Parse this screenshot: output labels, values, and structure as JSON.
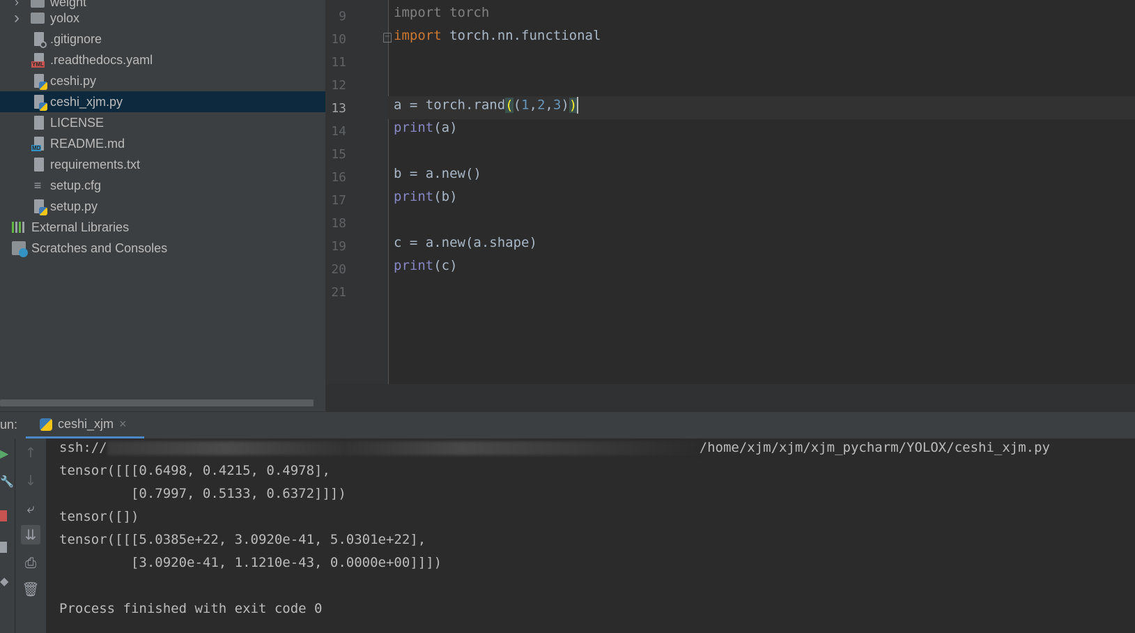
{
  "project_tree": {
    "items": [
      {
        "label": "weight",
        "type": "folder"
      },
      {
        "label": "yolox",
        "type": "folder"
      },
      {
        "label": ".gitignore",
        "type": "file-ignore"
      },
      {
        "label": ".readthedocs.yaml",
        "type": "file-yaml",
        "badge": "YML"
      },
      {
        "label": "ceshi.py",
        "type": "file-python"
      },
      {
        "label": "ceshi_xjm.py",
        "type": "file-python",
        "selected": true
      },
      {
        "label": "LICENSE",
        "type": "file-text"
      },
      {
        "label": "README.md",
        "type": "file-markdown",
        "badge": "MD"
      },
      {
        "label": "requirements.txt",
        "type": "file-text"
      },
      {
        "label": "setup.cfg",
        "type": "file-config"
      },
      {
        "label": "setup.py",
        "type": "file-python"
      }
    ],
    "external_libraries": "External Libraries",
    "scratches": "Scratches and Consoles"
  },
  "editor": {
    "current_line": 13,
    "lines": [
      {
        "n": "9",
        "text": "import torch"
      },
      {
        "n": "10",
        "text": "import torch.nn.functional"
      },
      {
        "n": "11",
        "text": ""
      },
      {
        "n": "12",
        "text": ""
      },
      {
        "n": "13",
        "text": "a = torch.rand((1,2,3))"
      },
      {
        "n": "14",
        "text": "print(a)"
      },
      {
        "n": "15",
        "text": ""
      },
      {
        "n": "16",
        "text": "b = a.new()"
      },
      {
        "n": "17",
        "text": "print(b)"
      },
      {
        "n": "18",
        "text": ""
      },
      {
        "n": "19",
        "text": "c = a.new(a.shape)"
      },
      {
        "n": "20",
        "text": "print(c)"
      },
      {
        "n": "21",
        "text": ""
      }
    ]
  },
  "run": {
    "label": "un:",
    "tab": "ceshi_xjm",
    "close": "×",
    "output": {
      "ssh_prefix": "ssh://",
      "ssh_suffix": "/home/xjm/xjm/xjm_pycharm/YOLOX/ceshi_xjm.py",
      "lines": [
        "tensor([[[0.6498, 0.4215, 0.4978],",
        "         [0.7997, 0.5133, 0.6372]]])",
        "tensor([])",
        "tensor([[[5.0385e+22, 3.0920e-41, 5.0301e+22],",
        "         [3.0920e-41, 1.1210e-43, 0.0000e+00]]])",
        "",
        "Process finished with exit code 0"
      ]
    }
  },
  "colors": {
    "selection": "#0d293e",
    "keyword": "#cc7832",
    "builtin": "#8888c6",
    "number": "#6897bb",
    "tab_underline": "#4a88c7"
  }
}
